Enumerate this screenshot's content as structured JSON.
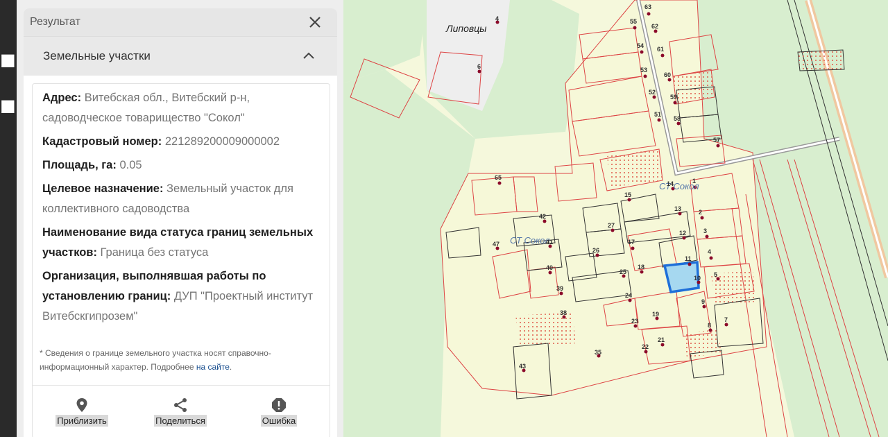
{
  "panel": {
    "title": "Результат",
    "section_title": "Земельные участки",
    "fields": [
      {
        "label": "Адрес:",
        "value": "Витебская обл., Витебский р-н, садоводческое товарищество \"Сокол\""
      },
      {
        "label": "Кадастровый номер:",
        "value": "221289200009000002"
      },
      {
        "label": "Площадь, га:",
        "value": "0.05"
      },
      {
        "label": "Целевое назначение:",
        "value": "Земельный участок для коллективного садоводства"
      },
      {
        "label": "Наименование вида статуса границ земельных участков:",
        "value": "Граница без статуса"
      },
      {
        "label": "Организация, выполнявшая работы по установлению границ:",
        "value": "ДУП \"Проектный институт Витебскгипрозем\""
      }
    ],
    "note": "* Сведения о границе земельного участка носят справочно-информационный характер. Подробнее",
    "note_link": "на сайте",
    "note_end": ".",
    "actions": {
      "zoom": "Приблизить",
      "share": "Поделиться",
      "error": "Ошибка"
    }
  },
  "map": {
    "village_label": "Липовцы",
    "st_label_1": "СТ Сокол",
    "st_label_2": "СТ Сокол",
    "parcel_numbers": [
      "63",
      "55",
      "62",
      "54",
      "61",
      "53",
      "60",
      "52",
      "59",
      "51",
      "58",
      "57",
      "65",
      "14",
      "1",
      "15",
      "13",
      "2",
      "42",
      "27",
      "12",
      "3",
      "41",
      "47",
      "17",
      "26",
      "11",
      "4",
      "40",
      "18",
      "25",
      "5",
      "10",
      "39",
      "24",
      "9",
      "38",
      "19",
      "23",
      "8",
      "7",
      "21",
      "22",
      "35",
      "43",
      "6",
      "4"
    ]
  }
}
